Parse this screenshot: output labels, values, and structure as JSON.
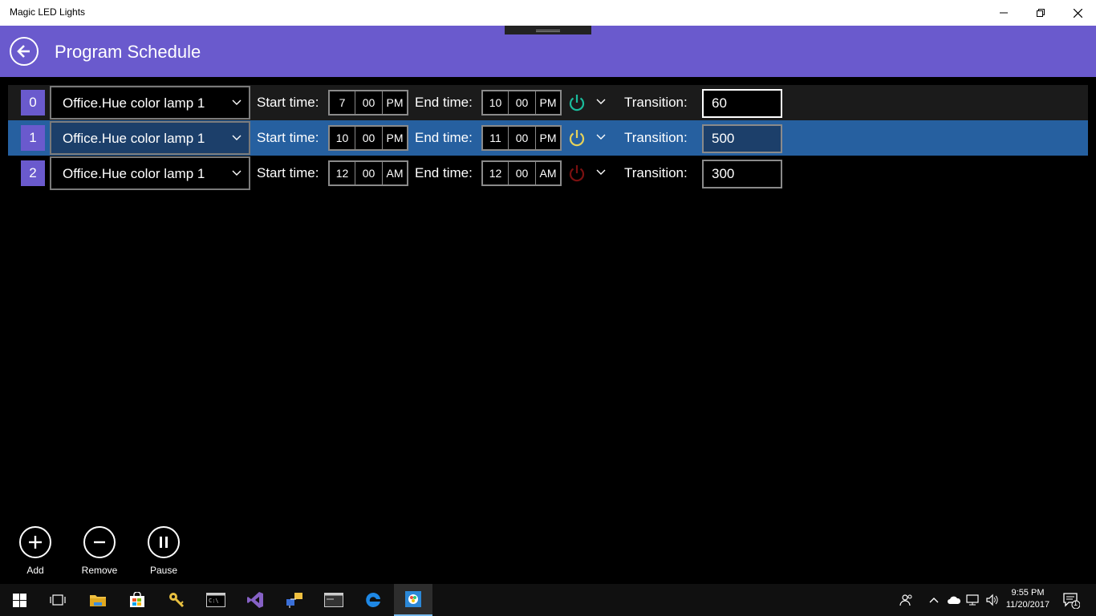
{
  "window": {
    "title": "Magic LED Lights"
  },
  "header": {
    "title": "Program Schedule"
  },
  "labels": {
    "start": "Start time:",
    "end": "End time:",
    "transition": "Transition:"
  },
  "rows": [
    {
      "index": "0",
      "device": "Office.Hue color lamp 1",
      "start": {
        "hour": "7",
        "minute": "00",
        "period": "PM"
      },
      "end": {
        "hour": "10",
        "minute": "00",
        "period": "PM"
      },
      "power_color": "#1abc9c",
      "transition": "60"
    },
    {
      "index": "1",
      "device": "Office.Hue color lamp 1",
      "start": {
        "hour": "10",
        "minute": "00",
        "period": "PM"
      },
      "end": {
        "hour": "11",
        "minute": "00",
        "period": "PM"
      },
      "power_color": "#e6d25a",
      "transition": "500"
    },
    {
      "index": "2",
      "device": "Office.Hue color lamp 1",
      "start": {
        "hour": "12",
        "minute": "00",
        "period": "AM"
      },
      "end": {
        "hour": "12",
        "minute": "00",
        "period": "AM"
      },
      "power_color": "#7a1010",
      "transition": "300"
    }
  ],
  "appbar": {
    "add": "Add",
    "remove": "Remove",
    "pause": "Pause"
  },
  "taskbar": {
    "time": "9:55 PM",
    "date": "11/20/2017",
    "notification_count": "1"
  },
  "colors": {
    "accent": "#6a5acd",
    "selected_row": "#2660a0"
  }
}
